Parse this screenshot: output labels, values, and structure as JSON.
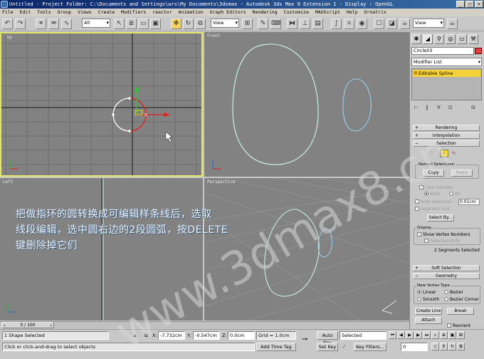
{
  "window": {
    "title": "Untitled      - Project Folder: C:\\Documents and Settings\\wrs\\My Documents\\3dsmax      - Autodesk 3ds Max 9 Extension 1                - Display : OpenGL",
    "min_label": "_",
    "max_label": "□",
    "close_label": "×"
  },
  "menu": [
    "File",
    "Edit",
    "Tools",
    "Group",
    "Views",
    "Create",
    "Modifiers",
    "reactor",
    "Animation",
    "Graph Editors",
    "Rendering",
    "Customize",
    "MAXScript",
    "Help",
    "Ornatrix"
  ],
  "toolbar": {
    "selection_filter": "All",
    "ref_coord_left": "View",
    "ref_coord_right": "View"
  },
  "viewports": {
    "top": "Top",
    "front": "Front",
    "left": "Left",
    "perspective": "Perspective"
  },
  "command_panel": {
    "object_name": "Circle03",
    "object_color": "#e84040",
    "modifier_list": "Modifier List",
    "stack_item": "Editable Spline",
    "rollouts": {
      "rendering": "Rendering",
      "interpolation": "Interpolation",
      "selection": "Selection",
      "soft_selection": "Soft Selection",
      "geometry": "Geometry"
    },
    "selection": {
      "named_selections": "Named Selections:",
      "copy": "Copy",
      "paste": "Paste",
      "lock_handles": "Lock Handles",
      "alike": "Alike",
      "all": "All",
      "area_selection": "Area Selection:",
      "area_value": "0.01cm",
      "segment_end": "Segment End",
      "select_by": "Select By...",
      "display": "Display",
      "show_vertex_numbers": "Show Vertex Numbers",
      "selected_only": "Selected Only",
      "status": "2 Segments Selected"
    },
    "geometry": {
      "new_vertex_type": "New Vertex Type",
      "linear": "Linear",
      "bezier": "Bezier",
      "smooth": "Smooth",
      "bezier_corner": "Bezier Corner",
      "create_line": "Create Line",
      "break": "Break",
      "attach": "Attach",
      "reorient": "Reorient"
    }
  },
  "timeslider": {
    "frame": "0 / 100"
  },
  "status": {
    "shapes_selected": "1 Shape Selected",
    "prompt": "Click or click-and-drag to select objects",
    "x_label": "X:",
    "x_value": "-7.732cm",
    "y_label": "Y:",
    "y_value": "-0.547cm",
    "z_label": "Z:",
    "z_value": "0.0cm",
    "grid": "Grid = 1.0cm",
    "add_time_tag": "Add Time Tag",
    "auto_key": "Auto Key",
    "set_key": "Set Key",
    "key_filter_value": "Selected",
    "key_filters": "Key Filters...",
    "current_frame": "0"
  },
  "overlay": {
    "line1": "把做指环的圆转换成可编辑样条线后，选取",
    "line2": "线段编辑，选中圆右边的2段圆弧，按DELETE",
    "line3": "键删除掉它们"
  },
  "watermark": "www.3dmax8.cn",
  "colors": {
    "viewport_bg": "#828282",
    "active_border": "#e4e46a",
    "spline_white": "#ffffff",
    "spline_selected": "#e02020",
    "spline_other": "#c8f0e0",
    "stack_highlight": "#f6d23a"
  }
}
